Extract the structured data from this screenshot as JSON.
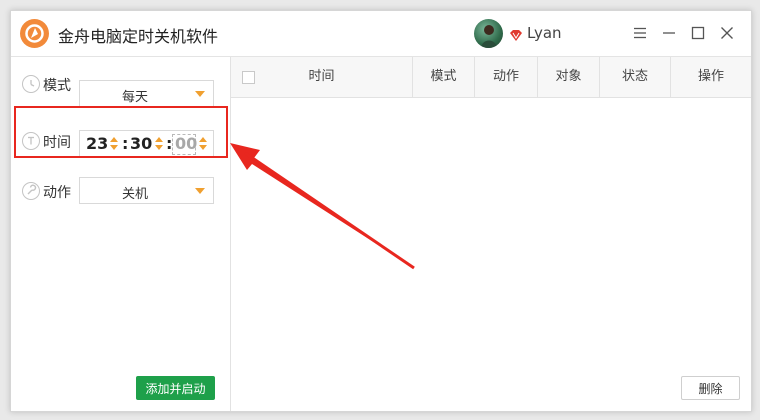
{
  "app": {
    "title": "金舟电脑定时关机软件",
    "username": "Lyan",
    "logo_icon": "app-logo-icon",
    "accent_color": "#f28a3a"
  },
  "titlebar_buttons": [
    {
      "name": "menu-icon"
    },
    {
      "name": "minimize-icon"
    },
    {
      "name": "maximize-icon"
    },
    {
      "name": "close-icon"
    }
  ],
  "form": {
    "mode": {
      "label": "模式",
      "value": "每天",
      "icon": "alarm-clock-icon"
    },
    "time": {
      "label": "时间",
      "icon": "clock-icon",
      "hour": "23",
      "minute": "30",
      "second": "00"
    },
    "action": {
      "label": "动作",
      "value": "关机",
      "icon": "wrench-icon"
    },
    "add_button": "添加并启动"
  },
  "table": {
    "columns": [
      "时间",
      "模式",
      "动作",
      "对象",
      "状态",
      "操作"
    ],
    "rows": [],
    "delete_button": "删除"
  },
  "colors": {
    "highlight_red": "#e8271f",
    "add_button_green": "#1ea04a",
    "spinner_orange": "#f0a030"
  }
}
